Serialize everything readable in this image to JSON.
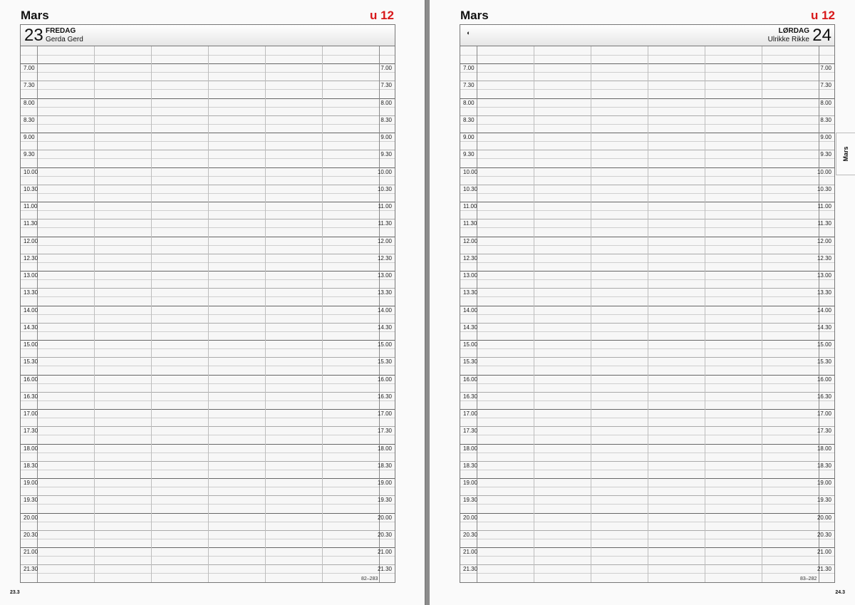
{
  "left_page": {
    "month": "Mars",
    "week": "u 12",
    "day_number": "23",
    "weekday": "FREDAG",
    "name_days": "Gerda Gerd",
    "day_count": "82–283",
    "footer_date": "23.3"
  },
  "right_page": {
    "month": "Mars",
    "week": "u 12",
    "day_number": "24",
    "weekday": "LØRDAG",
    "name_days": "Ulrikke Rikke",
    "moon_icon": "first-quarter-moon-icon",
    "moon_glyph": "◐",
    "day_count": "83–282",
    "footer_date": "24.3",
    "month_tab": "Mars"
  },
  "time_slots": [
    "7.00",
    "7.30",
    "8.00",
    "8.30",
    "9.00",
    "9.30",
    "10.00",
    "10.30",
    "11.00",
    "11.30",
    "12.00",
    "12.30",
    "13.00",
    "13.30",
    "14.00",
    "14.30",
    "15.00",
    "15.30",
    "16.00",
    "16.30",
    "17.00",
    "17.30",
    "18.00",
    "18.30",
    "19.00",
    "19.30",
    "20.00",
    "20.30",
    "21.00",
    "21.30"
  ],
  "colors": {
    "week_red": "#d8181a",
    "page_bg": "#fafafa",
    "spine": "#808080"
  }
}
